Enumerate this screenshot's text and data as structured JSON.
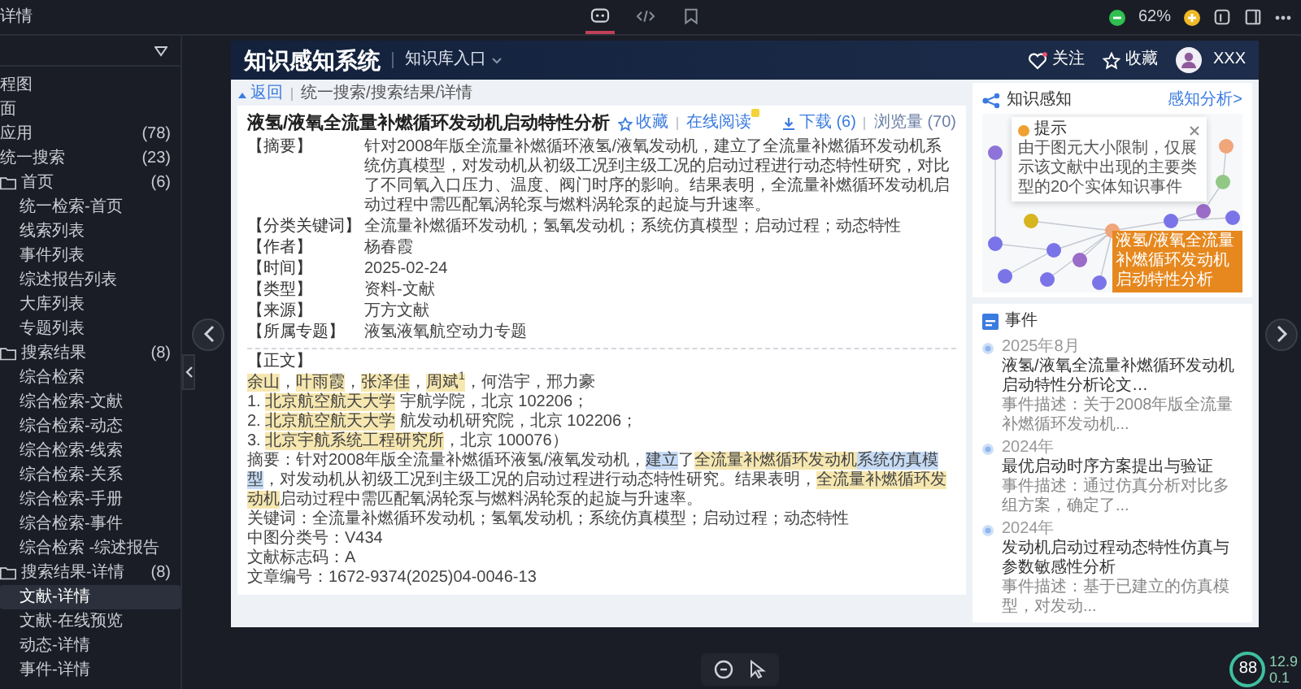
{
  "top_bar": {
    "title": "详情",
    "tabs": [
      {
        "selected": true
      },
      {
        "selected": false
      },
      {
        "selected": false
      }
    ],
    "zoom": "62%"
  },
  "sidebar": {
    "items": [
      {
        "label": "程图",
        "selected": false
      },
      {
        "label": "面",
        "selected": false
      },
      {
        "label": "应用",
        "count": "(78)",
        "selected": false
      },
      {
        "label": "统一搜索",
        "count": "(23)",
        "selected": false,
        "children": [
          {
            "label": "首页",
            "count": "(6)",
            "selected": false,
            "children": [
              {
                "label": "统一检索-首页",
                "selected": false
              },
              {
                "label": "线索列表",
                "selected": false
              },
              {
                "label": "事件列表",
                "selected": false
              },
              {
                "label": "综述报告列表",
                "selected": false
              },
              {
                "label": "大库列表",
                "selected": false
              },
              {
                "label": "专题列表",
                "selected": false
              }
            ]
          },
          {
            "label": "搜索结果",
            "count": "(8)",
            "selected": false,
            "children": [
              {
                "label": "综合检索",
                "selected": false
              },
              {
                "label": "综合检索-文献",
                "selected": false
              },
              {
                "label": "综合检索-动态",
                "selected": false
              },
              {
                "label": "综合检索-线索",
                "selected": false
              },
              {
                "label": "综合检索-关系",
                "selected": false
              },
              {
                "label": "综合检索-手册",
                "selected": false
              },
              {
                "label": "综合检索-事件",
                "selected": false
              },
              {
                "label": "综合检索 -综述报告",
                "selected": false
              }
            ]
          },
          {
            "label": "搜索结果-详情",
            "count": "(8)",
            "selected": false,
            "children": [
              {
                "label": "文献-详情",
                "selected": true
              },
              {
                "label": "文献-在线预览",
                "selected": false
              },
              {
                "label": "动态-详情",
                "selected": false
              },
              {
                "label": "事件-详情",
                "selected": false
              }
            ]
          }
        ]
      }
    ]
  },
  "page": {
    "brand": "知识感知系统",
    "nav": "知识库入口",
    "follow": "关注",
    "favorite": "收藏",
    "user": "XXX",
    "breadcrumb": {
      "back": "返回",
      "path": "统一搜索/搜索结果/详情"
    },
    "article": {
      "title": "液氢/液氧全流量补燃循环发动机启动特性分析",
      "favorite": "收藏",
      "read_online": "在线阅读",
      "download": "下载 (6)",
      "views": "浏览量 (70)",
      "fields": [
        {
          "label": "【摘要】",
          "value": "针对2008年版全流量补燃循环液氢/液氧发动机，建立了全流量补燃循环发动机系统仿真模型，对发动机从初级工况到主级工况的启动过程进行动态特性研究，对比了不同氧入口压力、温度、阀门时序的影响。结果表明，全流量补燃循环发动机启动过程中需匹配氧涡轮泵与燃料涡轮泵的起旋与升速率。"
        },
        {
          "label": "【分类关键词】",
          "value": "全流量补燃循环发动机；氢氧发动机；系统仿真模型；启动过程；动态特性"
        },
        {
          "label": "【作者】",
          "value": "杨春霞"
        },
        {
          "label": "【时间】",
          "value": "2025-02-24"
        },
        {
          "label": "【类型】",
          "value": "资料-文献"
        },
        {
          "label": "【来源】",
          "value": "万方文献"
        },
        {
          "label": "【所属专题】",
          "value": "液氢液氧航空动力专题"
        }
      ],
      "body_label": "【正文】",
      "body": [
        [
          {
            "text": "余山",
            "color": "#f6e7b0"
          },
          {
            "text": "，"
          },
          {
            "text": "叶雨霞",
            "color": "#f6e7b0"
          },
          {
            "text": "，"
          },
          {
            "text": "张泽佳",
            "color": "#f6e7b0"
          },
          {
            "text": "，"
          },
          {
            "text": "周斌$^{1}$",
            "color": "#f6e7b0"
          },
          {
            "text": "，何浩宇，邢力豪"
          }
        ],
        [
          {
            "text": "1. "
          },
          {
            "text": "北京航空航天大学",
            "color": "#f6e7b0"
          },
          {
            "text": " 宇航学院，北京 102206；"
          }
        ],
        [
          {
            "text": "2. "
          },
          {
            "text": "北京航空航天大学",
            "color": "#f6e7b0"
          },
          {
            "text": " 航发动机研究院，北京 102206；"
          }
        ],
        [
          {
            "text": "3. "
          },
          {
            "text": "北京宇航系统工程研究所",
            "color": "#f6e7b0"
          },
          {
            "text": "，北京 100076）"
          }
        ],
        [
          {
            "text": "摘要：针对2008年版全流量补燃循环液氢/液氧发动机，"
          },
          {
            "text": "建立",
            "color": "#c6dbf5"
          },
          {
            "text": "了"
          },
          {
            "text": "全流量补燃循环发动机",
            "color": "#f6e7b0"
          },
          {
            "text": "系统仿真模型",
            "color": "#c6dbf5"
          },
          {
            "text": "，对发动机从初级工况到主级工况的启动过程进行动态特性研究。结果表明，"
          },
          {
            "text": "全流量补燃循环发动机",
            "color": "#f6e7b0"
          },
          {
            "text": "启动过程中需匹配氧涡轮泵与燃料涡轮泵的起旋与升速率。"
          }
        ],
        [
          {
            "text": "关键词：全流量补燃循环发动机；氢氧发动机；系统仿真模型；启动过程；动态特性"
          }
        ],
        [
          {
            "text": "中图分类号：V434"
          }
        ],
        [
          {
            "text": "文献标志码：A"
          }
        ],
        [
          {
            "text": "文章编号：1672-9374(2025)04-0046-13"
          }
        ]
      ]
    },
    "knowledge": {
      "title": "知识感知",
      "link": "感知分析>",
      "tip_title": "提示",
      "tip_text": "由于图元大小限制，仅展示该文献中出现的主要类型的20个实体知识事件",
      "nodes": [
        {
          "color": "#f0a57a"
        },
        {
          "color": "#8e74d8"
        },
        {
          "color": "#d6b51f"
        },
        {
          "color": "#7a74e8"
        },
        {
          "color": "#7a74e8"
        },
        {
          "color": "#f0a57a"
        },
        {
          "color": "#7a74e8"
        },
        {
          "color": "#7a74e8"
        },
        {
          "color": "#7a74e8"
        },
        {
          "color": "#7a74e8"
        },
        {
          "color": "#7a74e8"
        },
        {
          "color": "#9a6cc8"
        },
        {
          "color": "#92c786"
        },
        {
          "color": "#9a6cc8"
        }
      ],
      "highlight_box": "液氢/液氧全流量补燃循环发动机启动特性分析"
    },
    "events": {
      "title": "事件",
      "items": [
        {
          "date": "2025年8月",
          "title": "液氢/液氧全流量补燃循环发动机启动特性分析论文…",
          "description": "事件描述：关于2008年版全流量补燃循环发动机..."
        },
        {
          "date": "2024年",
          "title": "最优启动时序方案提出与验证",
          "description": "事件描述：通过仿真分析对比多组方案，确定了..."
        },
        {
          "date": "2024年",
          "title": "发动机启动过程动态特性仿真与参数敏感性分析",
          "description": "事件描述：基于已建立的仿真模型，对发动..."
        }
      ]
    }
  },
  "gauge": {
    "value": "88",
    "readings": [
      "12.9",
      "0.1"
    ]
  }
}
